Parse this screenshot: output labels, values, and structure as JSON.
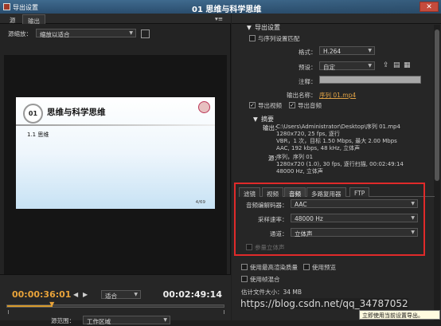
{
  "window": {
    "title": "导出设置",
    "ghost_title": "01 思维与科学思维",
    "close": "✕"
  },
  "left": {
    "tabs": [
      "源",
      "输出"
    ],
    "source_zoom_label": "源缩放：",
    "source_zoom_value": "缩放以适合",
    "slide": {
      "num": "01",
      "title": "思维与科学思维",
      "sub": "1.1 思维",
      "page": "4/69"
    },
    "current_time": "00:00:36:01",
    "duration": "00:02:49:14",
    "fit_value": "适合",
    "range_label": "源范围：",
    "range_value": "工作区域",
    "progress": 0.21
  },
  "right": {
    "export_header": "导出设置",
    "match_seq": "与序列设置匹配",
    "format_label": "格式：",
    "format_value": "H.264",
    "preset_label": "预设：",
    "preset_value": "自定",
    "comment_label": "注释：",
    "outname_label": "输出名称：",
    "outname_value": "序列 01.mp4",
    "export_video": "导出视频",
    "export_audio": "导出音频",
    "summary_header": "摘要",
    "output_label": "输出：",
    "output_lines": [
      "C:\\Users\\Administrator\\Desktop\\序列 01.mp4",
      "1280x720, 25 fps, 逐行",
      "VBR，1 次，目标 1.50 Mbps, 最大 2.00 Mbps",
      "AAC, 192 kbps, 48 kHz, 立体声"
    ],
    "source_label": "源：",
    "source_lines": [
      "序列，序列 01",
      "1280x720 (1.0), 30 fps, 逐行扫描, 00:02:49:14",
      "48000 Hz, 立体声"
    ],
    "tabs": [
      "滤镜",
      "视频",
      "音频",
      "多路复用器",
      "FTP"
    ],
    "codec_label": "音频编解码器：",
    "codec_value": "AAC",
    "sample_label": "采样速率：",
    "sample_value": "48000 Hz",
    "channel_label": "通道：",
    "channel_value": "立体声",
    "param_stereo": "参量立体声",
    "max_quality": "使用最高渲染质量",
    "use_preview": "使用预览",
    "frame_blend": "使用帧混合",
    "est_size": "估计文件大小：34 MB",
    "watermark": "https://blog.csdn.net/qq_34787052",
    "tooltip": "立即使用当前设置导出。"
  }
}
